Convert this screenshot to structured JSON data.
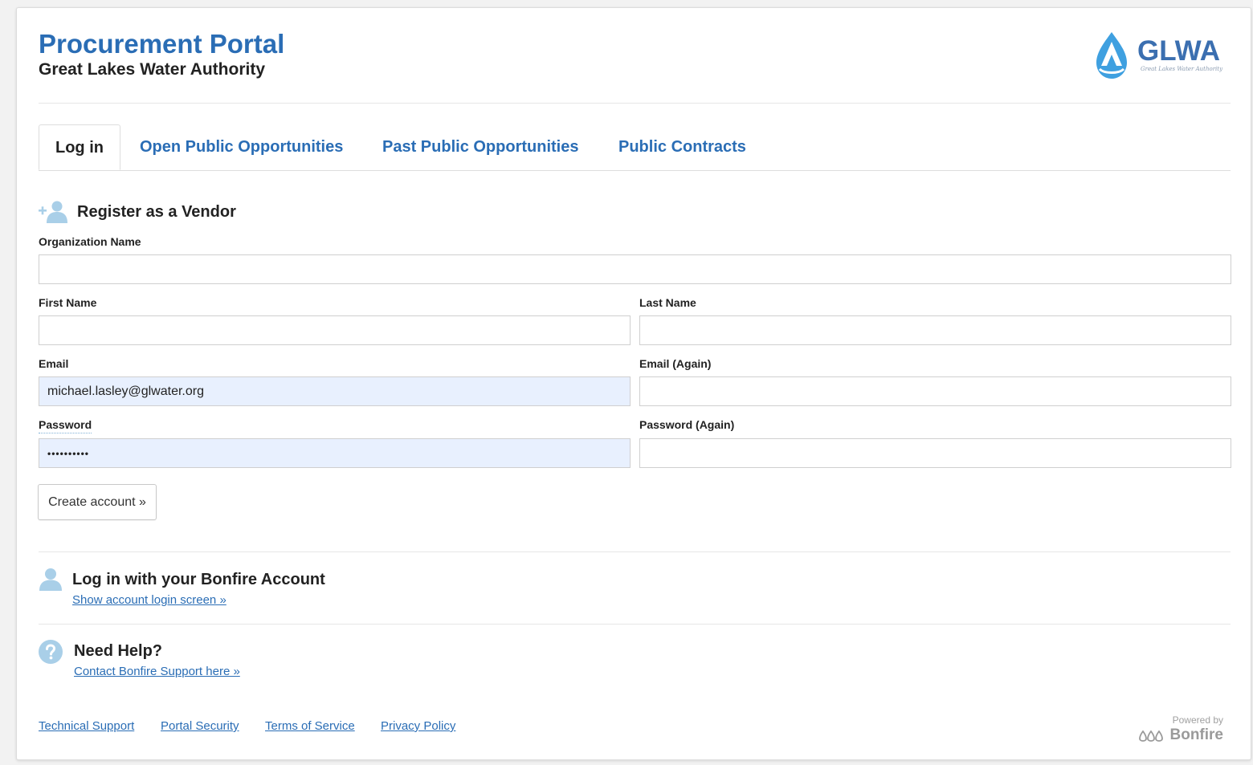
{
  "header": {
    "title": "Procurement Portal",
    "subtitle": "Great Lakes Water Authority",
    "logo_text": "GLWA",
    "logo_tagline": "Great Lakes Water Authority"
  },
  "tabs": [
    {
      "label": "Log in",
      "active": true
    },
    {
      "label": "Open Public Opportunities",
      "active": false
    },
    {
      "label": "Past Public Opportunities",
      "active": false
    },
    {
      "label": "Public Contracts",
      "active": false
    }
  ],
  "register": {
    "title": "Register as a Vendor",
    "org_label": "Organization Name",
    "org_value": "",
    "first_name_label": "First Name",
    "first_name_value": "",
    "last_name_label": "Last Name",
    "last_name_value": "",
    "email_label": "Email",
    "email_value": "michael.lasley@glwater.org",
    "email_again_label": "Email (Again)",
    "email_again_value": "",
    "password_label": "Password",
    "password_value": "••••••••••",
    "password_again_label": "Password (Again)",
    "password_again_value": "",
    "submit_label": "Create account »"
  },
  "bonfire_login": {
    "title": "Log in with your Bonfire Account",
    "link": "Show account login screen »"
  },
  "help": {
    "title": "Need Help?",
    "link": "Contact Bonfire Support here »"
  },
  "footer": {
    "links": [
      "Technical Support",
      "Portal Security",
      "Terms of Service",
      "Privacy Policy"
    ],
    "powered_by": "Powered by",
    "brand": "Bonfire"
  },
  "colors": {
    "brand_blue": "#2a6db5",
    "icon_blue": "#a9cfe8",
    "autofill_bg": "#e8f0fe"
  },
  "icons": {
    "add_user": "add-user-icon",
    "user": "user-icon",
    "help": "help-icon",
    "logo": "glwa-logo-icon",
    "bonfire": "bonfire-logo-icon"
  }
}
